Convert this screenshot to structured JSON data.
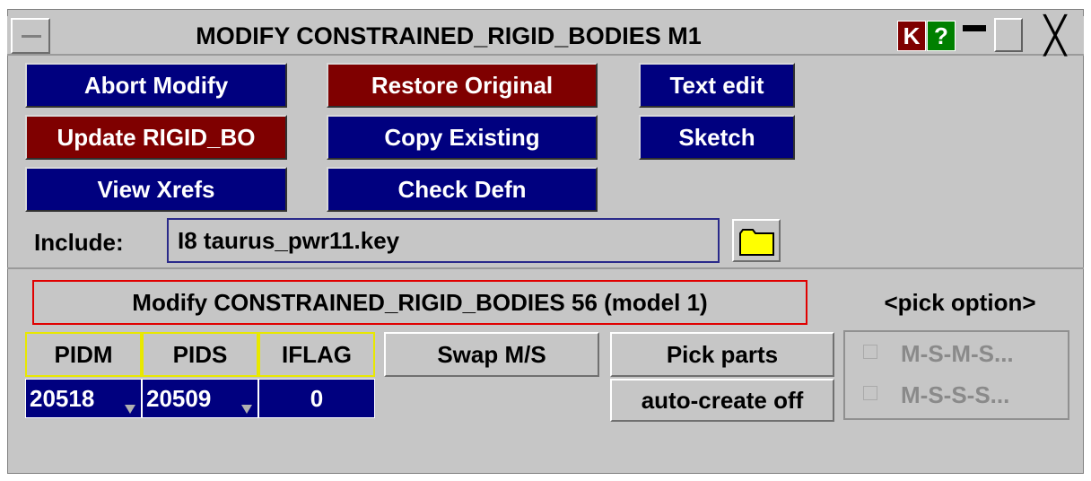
{
  "window": {
    "title": "MODIFY CONSTRAINED_RIGID_BODIES M1",
    "k_label": "K",
    "help_label": "?",
    "minimize_glyph": "▬",
    "close_glyph": "╳"
  },
  "buttons": {
    "abort_modify": "Abort Modify",
    "restore_original": "Restore Original",
    "text_edit": "Text edit",
    "update": "Update RIGID_BO",
    "copy_existing": "Copy Existing",
    "sketch": "Sketch",
    "view_xrefs": "View Xrefs",
    "check_defn": "Check Defn"
  },
  "include": {
    "label": "Include:",
    "value": "I8  taurus_pwr11.key"
  },
  "status": {
    "message": "Modify CONSTRAINED_RIGID_BODIES 56 (model 1)",
    "pick_option": "<pick option>"
  },
  "table": {
    "headers": [
      "PIDM",
      "PIDS",
      "IFLAG"
    ],
    "values": [
      "20518",
      "20509",
      "0"
    ]
  },
  "actions": {
    "swap": "Swap M/S",
    "pick_parts": "Pick parts",
    "auto_create": "auto-create off"
  },
  "options": {
    "option1": "M-S-M-S...",
    "option2": "M-S-S-S..."
  },
  "colors": {
    "navy": "#00007f",
    "maroon": "#7f0000",
    "panel": "#c6c6c6",
    "folder": "#ffff00"
  }
}
